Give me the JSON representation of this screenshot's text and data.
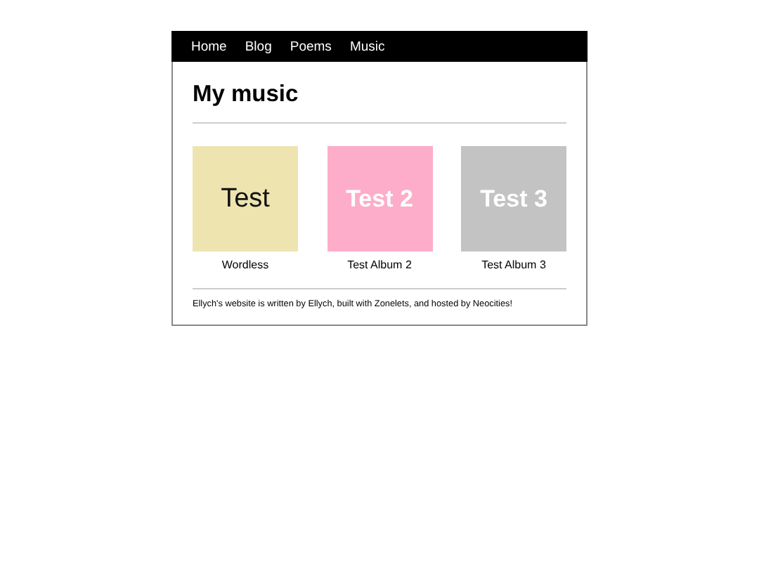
{
  "nav": {
    "items": [
      "Home",
      "Blog",
      "Poems",
      "Music"
    ]
  },
  "title": "My music",
  "albums": [
    {
      "cover_text": "Test",
      "kind": "plain",
      "color": "#eee4b0",
      "caption": "Wordless"
    },
    {
      "cover_text": "Test 2",
      "kind": "bold",
      "color": "#fdadc9",
      "caption": "Test Album 2"
    },
    {
      "cover_text": "Test 3",
      "kind": "bold",
      "color": "#c3c3c3",
      "caption": "Test Album 3"
    }
  ],
  "footer": "Ellych's website is written by Ellych, built with Zonelets, and hosted by Neocities!"
}
